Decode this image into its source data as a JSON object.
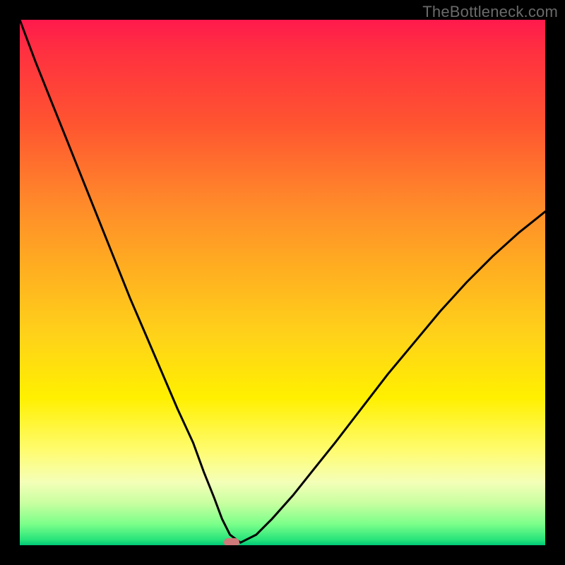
{
  "watermark": "TheBottleneck.com",
  "colors": {
    "frame": "#000000",
    "gradient_top": "#ff1a4d",
    "gradient_bottom": "#00c877",
    "curve": "#000000",
    "marker": "#cf7a7a",
    "watermark": "#6a6a6a"
  },
  "chart_data": {
    "type": "line",
    "title": "",
    "xlabel": "",
    "ylabel": "",
    "xlim": [
      0,
      100
    ],
    "ylim": [
      0,
      100
    ],
    "series": [
      {
        "name": "bottleneck-curve",
        "x": [
          0,
          3,
          6,
          9,
          12,
          15,
          18,
          21,
          24,
          27,
          30,
          33,
          35,
          37,
          38.5,
          40,
          42,
          45,
          48,
          52,
          56,
          60,
          65,
          70,
          75,
          80,
          85,
          90,
          95,
          100
        ],
        "y": [
          100,
          92,
          84.5,
          77,
          69.5,
          62,
          54.5,
          47,
          40,
          33,
          26,
          19.5,
          14,
          9,
          5,
          2,
          0.5,
          2,
          5,
          9.5,
          14.5,
          19.5,
          26,
          32.5,
          38.5,
          44.5,
          50,
          55,
          59.5,
          63.5
        ]
      }
    ],
    "marker": {
      "x": 40.3,
      "y": 0.5
    },
    "minimum_at_x_percent": 40.3
  }
}
